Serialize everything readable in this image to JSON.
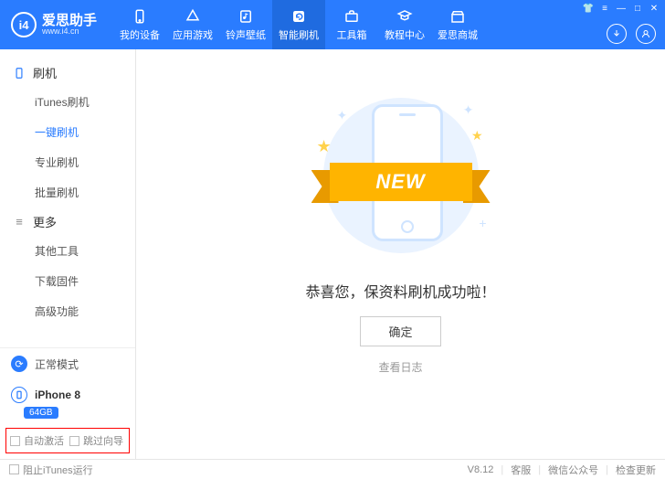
{
  "app": {
    "name": "爱思助手",
    "url": "www.i4.cn",
    "logo_text": "i4"
  },
  "nav": [
    {
      "label": "我的设备",
      "icon": "device"
    },
    {
      "label": "应用游戏",
      "icon": "apps"
    },
    {
      "label": "铃声壁纸",
      "icon": "music"
    },
    {
      "label": "智能刷机",
      "icon": "flash",
      "active": true
    },
    {
      "label": "工具箱",
      "icon": "toolbox"
    },
    {
      "label": "教程中心",
      "icon": "tutorial"
    },
    {
      "label": "爱思商城",
      "icon": "store"
    }
  ],
  "sidebar": {
    "group1": {
      "title": "刷机",
      "items": [
        "iTunes刷机",
        "一键刷机",
        "专业刷机",
        "批量刷机"
      ],
      "active_index": 1
    },
    "group2": {
      "title": "更多",
      "items": [
        "其他工具",
        "下载固件",
        "高级功能"
      ]
    },
    "mode": "正常模式",
    "device": {
      "name": "iPhone 8",
      "storage": "64GB"
    },
    "checks": {
      "auto_activate": "自动激活",
      "skip_wizard": "跳过向导"
    }
  },
  "main": {
    "ribbon": "NEW",
    "message": "恭喜您，保资料刷机成功啦！",
    "confirm": "确定",
    "view_log": "查看日志"
  },
  "footer": {
    "block_itunes": "阻止iTunes运行",
    "version": "V8.12",
    "links": [
      "客服",
      "微信公众号",
      "检查更新"
    ]
  }
}
